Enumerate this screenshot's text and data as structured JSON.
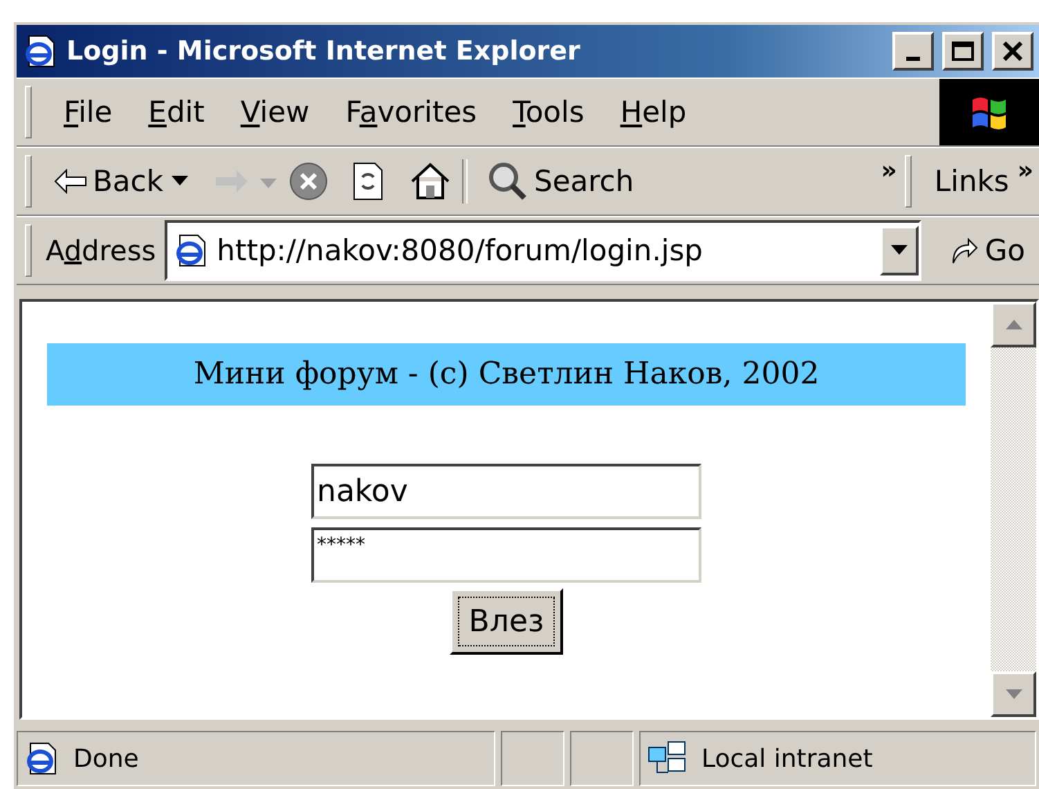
{
  "window": {
    "title": "Login - Microsoft Internet Explorer"
  },
  "menu": [
    {
      "key": "F",
      "post": "ile"
    },
    {
      "key": "E",
      "post": "dit"
    },
    {
      "key": "V",
      "post": "iew"
    },
    {
      "pre": "F",
      "key": "a",
      "post": "vorites"
    },
    {
      "key": "T",
      "post": "ools"
    },
    {
      "key": "H",
      "post": "elp"
    }
  ],
  "toolbar": {
    "back": "Back",
    "search": "Search",
    "more": "»",
    "links": "Links",
    "links_more": "»"
  },
  "address": {
    "label_pre": "A",
    "label_key": "d",
    "label_post": "dress",
    "url": "http://nakov:8080/forum/login.jsp",
    "go": "Go"
  },
  "page": {
    "banner": "Мини форум - (c) Светлин Наков, 2002",
    "username": "nakov",
    "password": "*****",
    "submit": "Влез"
  },
  "status_bar": {
    "text": "Done",
    "zone": "Local intranet"
  }
}
